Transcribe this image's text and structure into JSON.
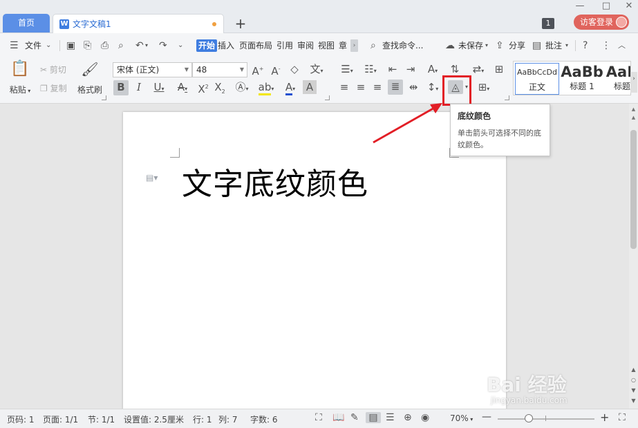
{
  "titlebar": {
    "home_tab": "首页",
    "doc_tab": "文字文稿1",
    "doc_icon": "W",
    "new_tab": "+",
    "badge": "1",
    "login": "访客登录"
  },
  "menubar": {
    "file": "文件",
    "tabs": [
      "开始",
      "插入",
      "页面布局",
      "引用",
      "审阅",
      "视图",
      "章"
    ],
    "search": "查找命令...",
    "unsaved": "未保存",
    "share": "分享",
    "comment": "批注",
    "help": "?"
  },
  "ribbon": {
    "paste": "粘贴",
    "cut": "剪切",
    "copy": "复制",
    "format_painter": "格式刷",
    "font_name": "宋体 (正文)",
    "font_size": "48",
    "styles": [
      {
        "preview": "AaBbCcDd",
        "label": "正文"
      },
      {
        "preview": "AaBb",
        "label": "标题 1"
      },
      {
        "preview": "AaB",
        "label": "标题"
      }
    ]
  },
  "tooltip": {
    "title": "底纹颜色",
    "description": "单击箭头可选择不同的底纹颜色。"
  },
  "document": {
    "text": "文字底纹颜色"
  },
  "statusbar": {
    "page_num": "页码: 1",
    "pages": "页面: 1/1",
    "section": "节: 1/1",
    "setting": "设置值: 2.5厘米",
    "row": "行: 1",
    "col": "列: 7",
    "words": "字数: 6",
    "zoom": "70%"
  },
  "watermark": {
    "brand": "Bai 经验",
    "url": "jingyan.baidu.com"
  },
  "colors": {
    "accent": "#3f7de0",
    "home_tab": "#5b8fe6",
    "login_button": "#e0645d",
    "highlight": "#e21e26"
  }
}
